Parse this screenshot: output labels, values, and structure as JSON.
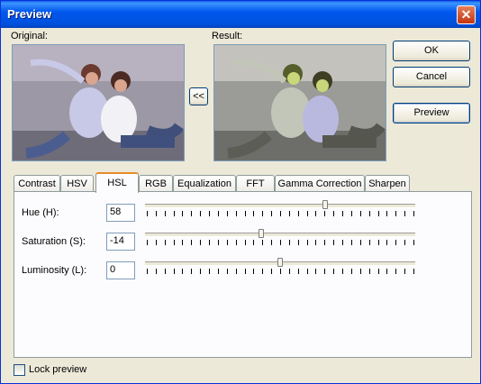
{
  "window": {
    "title": "Preview",
    "close_symbol": "✕"
  },
  "labels": {
    "original": "Original:",
    "result": "Result:"
  },
  "buttons": {
    "ok": "OK",
    "cancel": "Cancel",
    "preview": "Preview",
    "copy_back": "<<"
  },
  "tabs": [
    {
      "label": "Contrast"
    },
    {
      "label": "HSV"
    },
    {
      "label": "HSL",
      "active": true
    },
    {
      "label": "RGB"
    },
    {
      "label": "Equalization"
    },
    {
      "label": "FFT"
    },
    {
      "label": "Gamma Correction"
    },
    {
      "label": "Sharpen"
    }
  ],
  "hsl": {
    "hue": {
      "label": "Hue (H):",
      "value": "58",
      "level": 0.67
    },
    "saturation": {
      "label": "Saturation (S):",
      "value": "-14",
      "level": 0.43
    },
    "luminosity": {
      "label": "Luminosity (L):",
      "value": "0",
      "level": 0.5
    }
  },
  "lock_preview": {
    "label": "Lock preview",
    "checked": false
  },
  "colors": {
    "title_bar": "#0058ee",
    "dialog_bg": "#ece9d8",
    "active_tab_accent": "#e68b2c",
    "close_button": "#c3350f"
  }
}
